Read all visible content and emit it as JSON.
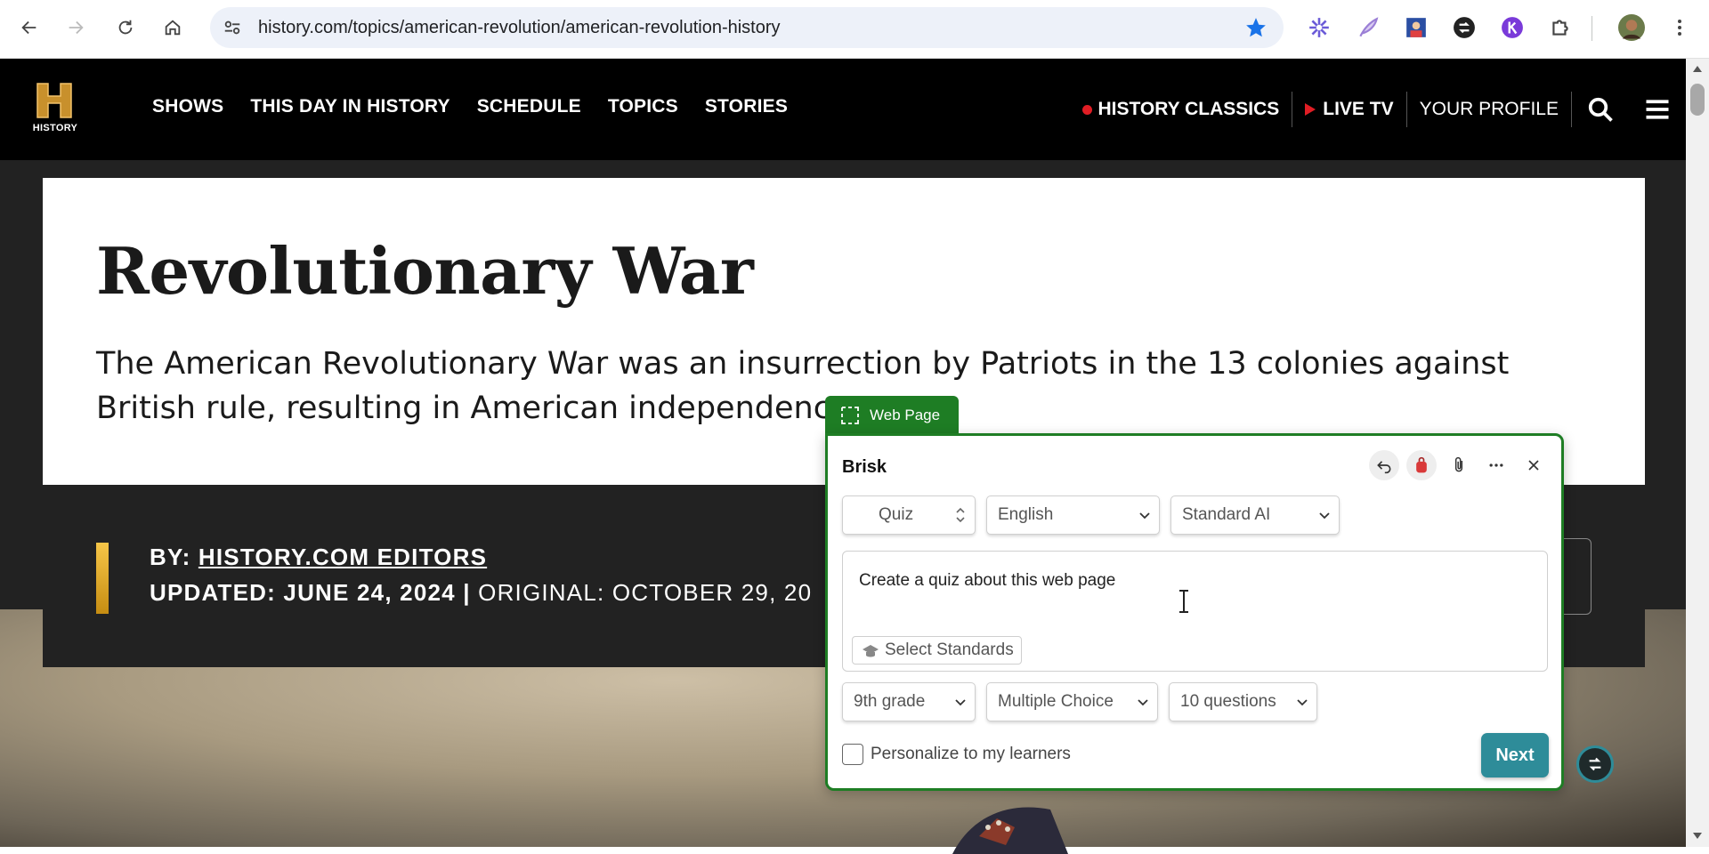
{
  "browser": {
    "url": "history.com/topics/american-revolution/american-revolution-history",
    "bookmark_color": "#1a73e8"
  },
  "site": {
    "logo_text": "HISTORY",
    "nav": [
      "SHOWS",
      "THIS DAY IN HISTORY",
      "SCHEDULE",
      "TOPICS",
      "STORIES"
    ],
    "right_nav": {
      "classics": "HISTORY CLASSICS",
      "live": "LIVE TV",
      "profile": "YOUR PROFILE"
    }
  },
  "article": {
    "title": "Revolutionary War",
    "description": "The American Revolutionary War was an insurrection by Patriots in the 13 colonies against British rule, resulting in American independence.",
    "by_label": "BY: ",
    "by_name": "HISTORY.COM EDITORS",
    "updated": "UPDATED: JUNE 24, 2024",
    "separator": " | ",
    "original": "ORIGINAL: OCTOBER 29, 20"
  },
  "brisk": {
    "tab_label": "Web Page",
    "title": "Brisk",
    "type_select": "Quiz",
    "language_select": "English",
    "model_select": "Standard AI",
    "prompt": "Create a quiz about this web page",
    "standards_button": "Select Standards",
    "grade_select": "9th grade",
    "format_select": "Multiple Choice",
    "count_select": "10 questions",
    "personalize_label": "Personalize to my learners",
    "personalize_checked": false,
    "next_button": "Next",
    "accent_color": "#1e7d24",
    "button_color": "#2e8c99"
  }
}
